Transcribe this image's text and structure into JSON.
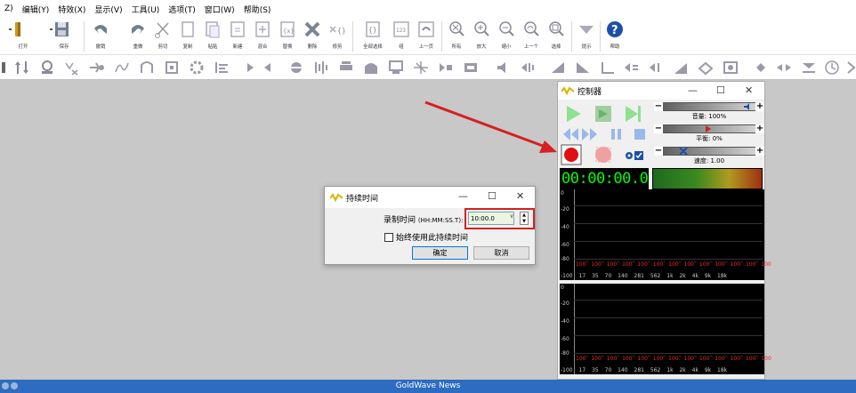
{
  "menu": [
    "Z)",
    "编辑(Y)",
    "特效(X)",
    "显示(V)",
    "工具(U)",
    "选项(T)",
    "窗口(W)",
    "帮助(S)"
  ],
  "toolbar": {
    "buttons": [
      {
        "label": "打开",
        "icon": "open-icon"
      },
      {
        "label": "保存",
        "icon": "save-icon"
      },
      {
        "label": "撤销",
        "icon": "undo-icon"
      },
      {
        "label": "重做",
        "icon": "redo-icon"
      },
      {
        "label": "剪切",
        "icon": "cut-icon"
      },
      {
        "label": "复制",
        "icon": "copy-icon"
      },
      {
        "label": "粘贴",
        "icon": "paste-icon"
      },
      {
        "label": "新建",
        "icon": "paste-new-icon"
      },
      {
        "label": "混合",
        "icon": "mix-icon"
      },
      {
        "label": "替换",
        "icon": "replace-icon"
      },
      {
        "label": "删除",
        "icon": "delete-icon"
      },
      {
        "label": "修剪",
        "icon": "trim-icon"
      },
      {
        "label": "全部选择",
        "icon": "select-all-icon"
      },
      {
        "label": "组",
        "icon": "group-icon"
      },
      {
        "label": "上一页",
        "icon": "previous-icon"
      },
      {
        "label": "所有",
        "icon": "zoom-all-icon"
      },
      {
        "label": "放大",
        "icon": "zoom-in-icon"
      },
      {
        "label": "缩小",
        "icon": "zoom-out-icon"
      },
      {
        "label": "上一个",
        "icon": "zoom-previous-icon"
      },
      {
        "label": "选择",
        "icon": "zoom-select-icon"
      },
      {
        "label": "提示",
        "icon": "cue-icon"
      },
      {
        "label": "帮助",
        "icon": "help-icon"
      }
    ]
  },
  "dialog": {
    "title": "持续时间",
    "label": "录制时间",
    "label_hint": "(HH:MM:SS.T):",
    "value": "10:00.0",
    "checkbox_label": "始终使用此持续时间",
    "ok": "确定",
    "cancel": "取消"
  },
  "control": {
    "title": "控制器",
    "volume": "音量: 100%",
    "balance": "平衡: 0%",
    "speed": "速度: 1.00",
    "timer": "00:00:00.0",
    "scale_ticks": [
      "0",
      "-20",
      "-40",
      "-60",
      "-80",
      "-100"
    ],
    "peak_values": "100‾ 100‾ 100‾ 100‾ 100‾ 100‾ 100‾ 100‾ 100‾ 100‾ 100‾ 100‾ 100",
    "freq_labels": "17 35 70 140 281 562 1k 2k 4k 9k 18k"
  },
  "status_bar": {
    "app_name": "GoldWave News"
  },
  "colors": {
    "record": "#e01010",
    "annotation": "#d62020",
    "status_bar": "#2d6cc0",
    "timer": "#00ff00"
  }
}
